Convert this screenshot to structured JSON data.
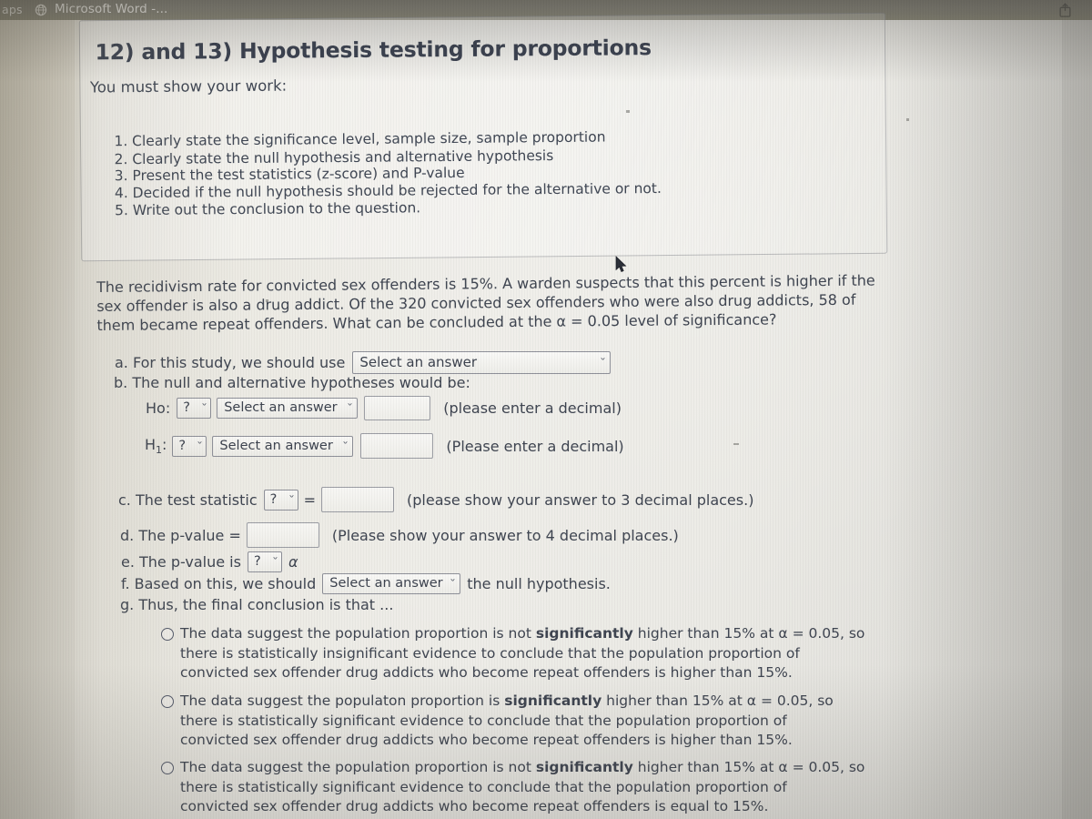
{
  "browser": {
    "bookmark_label": "aps",
    "tab_title": "Microsoft Word -...",
    "globe_icon": "globe-icon",
    "share_icon": "share-upload-icon"
  },
  "question": {
    "title": "12) and 13) Hypothesis testing for proportions",
    "show_work_label": "You must show your work:",
    "requirements": [
      "1. Clearly state the significance level, sample size, sample proportion",
      "2. Clearly state the null hypothesis and alternative hypothesis",
      "3. Present the test statistics (z-score) and P-value",
      "4. Decided if the null hypothesis should be rejected for the alternative or not.",
      "5. Write out the conclusion to the question."
    ],
    "problem_lines": [
      "The recidivism rate for convicted sex offenders is 15%.  A warden suspects that this percent is higher if the",
      "sex offender is also a drug addict. Of the 320 convicted sex offenders who were also drug addicts, 58 of",
      "them became repeat offenders. What can be concluded at the α = 0.05 level of significance?"
    ]
  },
  "form": {
    "part_a": {
      "label": "a. For this study, we should use",
      "select_value": "Select an answer"
    },
    "part_b": {
      "label": "b. The null and alternative hypotheses would be:",
      "ho_label": "Ho:",
      "ho_symbol_select": "?",
      "ho_answer_select": "Select an answer",
      "ho_value": "",
      "ho_hint": "(please enter a decimal)",
      "h1_label": "H",
      "h1_subscript": "1",
      "h1_colon": ":",
      "h1_symbol_select": "?",
      "h1_answer_select": "Select an answer",
      "h1_value": "",
      "h1_hint": "(Please enter a decimal)"
    },
    "part_c": {
      "label": "c. The test statistic",
      "symbol_select": "?",
      "equals": "=",
      "value": "",
      "hint": "(please show your answer to 3 decimal places.)"
    },
    "part_d": {
      "label": "d. The p-value =",
      "value": "",
      "hint": "(Please show your answer to 4 decimal places.)"
    },
    "part_e": {
      "label": "e. The p-value is",
      "symbol_select": "?",
      "alpha": "α"
    },
    "part_f": {
      "label_before": "f. Based on this, we should",
      "select_value": "Select an answer",
      "label_after": "the null hypothesis."
    },
    "part_g": {
      "label": "g. Thus, the final conclusion is that ..."
    }
  },
  "conclusion_options": [
    {
      "lines": [
        [
          "The data suggest the population proportion is not ",
          "significantly",
          " higher than 15% at α = 0.05, so"
        ],
        [
          "there is statistically insignificant evidence to conclude that the population proportion of"
        ],
        [
          "convicted sex offender drug addicts who become repeat offenders is higher than 15%."
        ]
      ]
    },
    {
      "lines": [
        [
          "The data suggest the populaton proportion is ",
          "significantly",
          " higher than 15% at α = 0.05, so"
        ],
        [
          "there is statistically significant evidence to conclude that the population proportion of"
        ],
        [
          "convicted sex offender drug addicts who become repeat offenders is higher than 15%."
        ]
      ]
    },
    {
      "lines": [
        [
          "The data suggest the population proportion is not ",
          "significantly",
          " higher than 15% at α = 0.05, so"
        ],
        [
          "there is statistically significant evidence to conclude that the population proportion of"
        ],
        [
          "convicted sex offender drug addicts who become repeat offenders is equal to 15%."
        ]
      ]
    }
  ],
  "cursor": {
    "name": "mouse-pointer"
  },
  "colors": {
    "text": "#3e4450",
    "chrome_bar": "#7c7a6f",
    "panel_border": "#6e7076",
    "field_border": "#8e9099"
  }
}
